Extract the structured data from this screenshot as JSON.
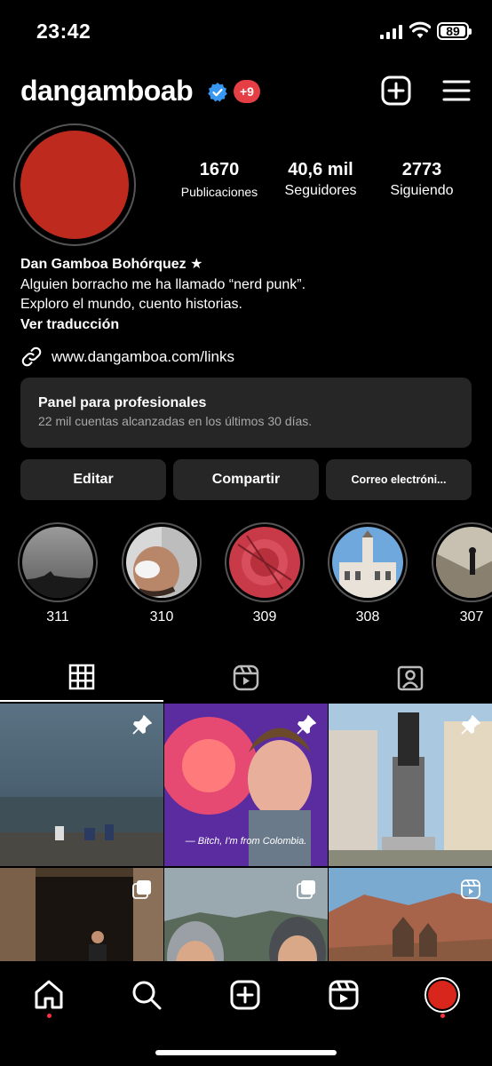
{
  "status_bar": {
    "time": "23:42",
    "battery": "89"
  },
  "header": {
    "username": "dangamboab",
    "notifications": "+9"
  },
  "profile": {
    "stats": [
      {
        "value": "1670",
        "label": "Publicaciones"
      },
      {
        "value": "40,6 mil",
        "label": "Seguidores"
      },
      {
        "value": "2773",
        "label": "Siguiendo"
      }
    ],
    "name": "Dan Gamboa Bohórquez ★",
    "bio_line1": "Alguien borracho me ha llamado “nerd punk”.",
    "bio_line2": "Exploro el mundo, cuento historias.",
    "translate": "Ver traducción",
    "link": "www.dangamboa.com/links"
  },
  "pro_panel": {
    "title": "Panel para profesionales",
    "subtitle": "22 mil cuentas alcanzadas en los últimos 30 días."
  },
  "buttons": {
    "edit": "Editar",
    "share": "Compartir",
    "email": "Correo electróni..."
  },
  "highlights": [
    "311",
    "310",
    "309",
    "308",
    "307"
  ],
  "tabs": [
    "grid-icon",
    "reels-icon",
    "tagged-icon"
  ],
  "grid": {
    "caption": "— Bitch, I'm from Colombia."
  },
  "nav": [
    "home-icon",
    "search-icon",
    "create-icon",
    "reels-icon",
    "profile-avatar"
  ],
  "colors": {
    "avatar": "#bf2a1f",
    "badge": "#e53e44",
    "verified": "#3897f0",
    "panel": "#262626"
  }
}
